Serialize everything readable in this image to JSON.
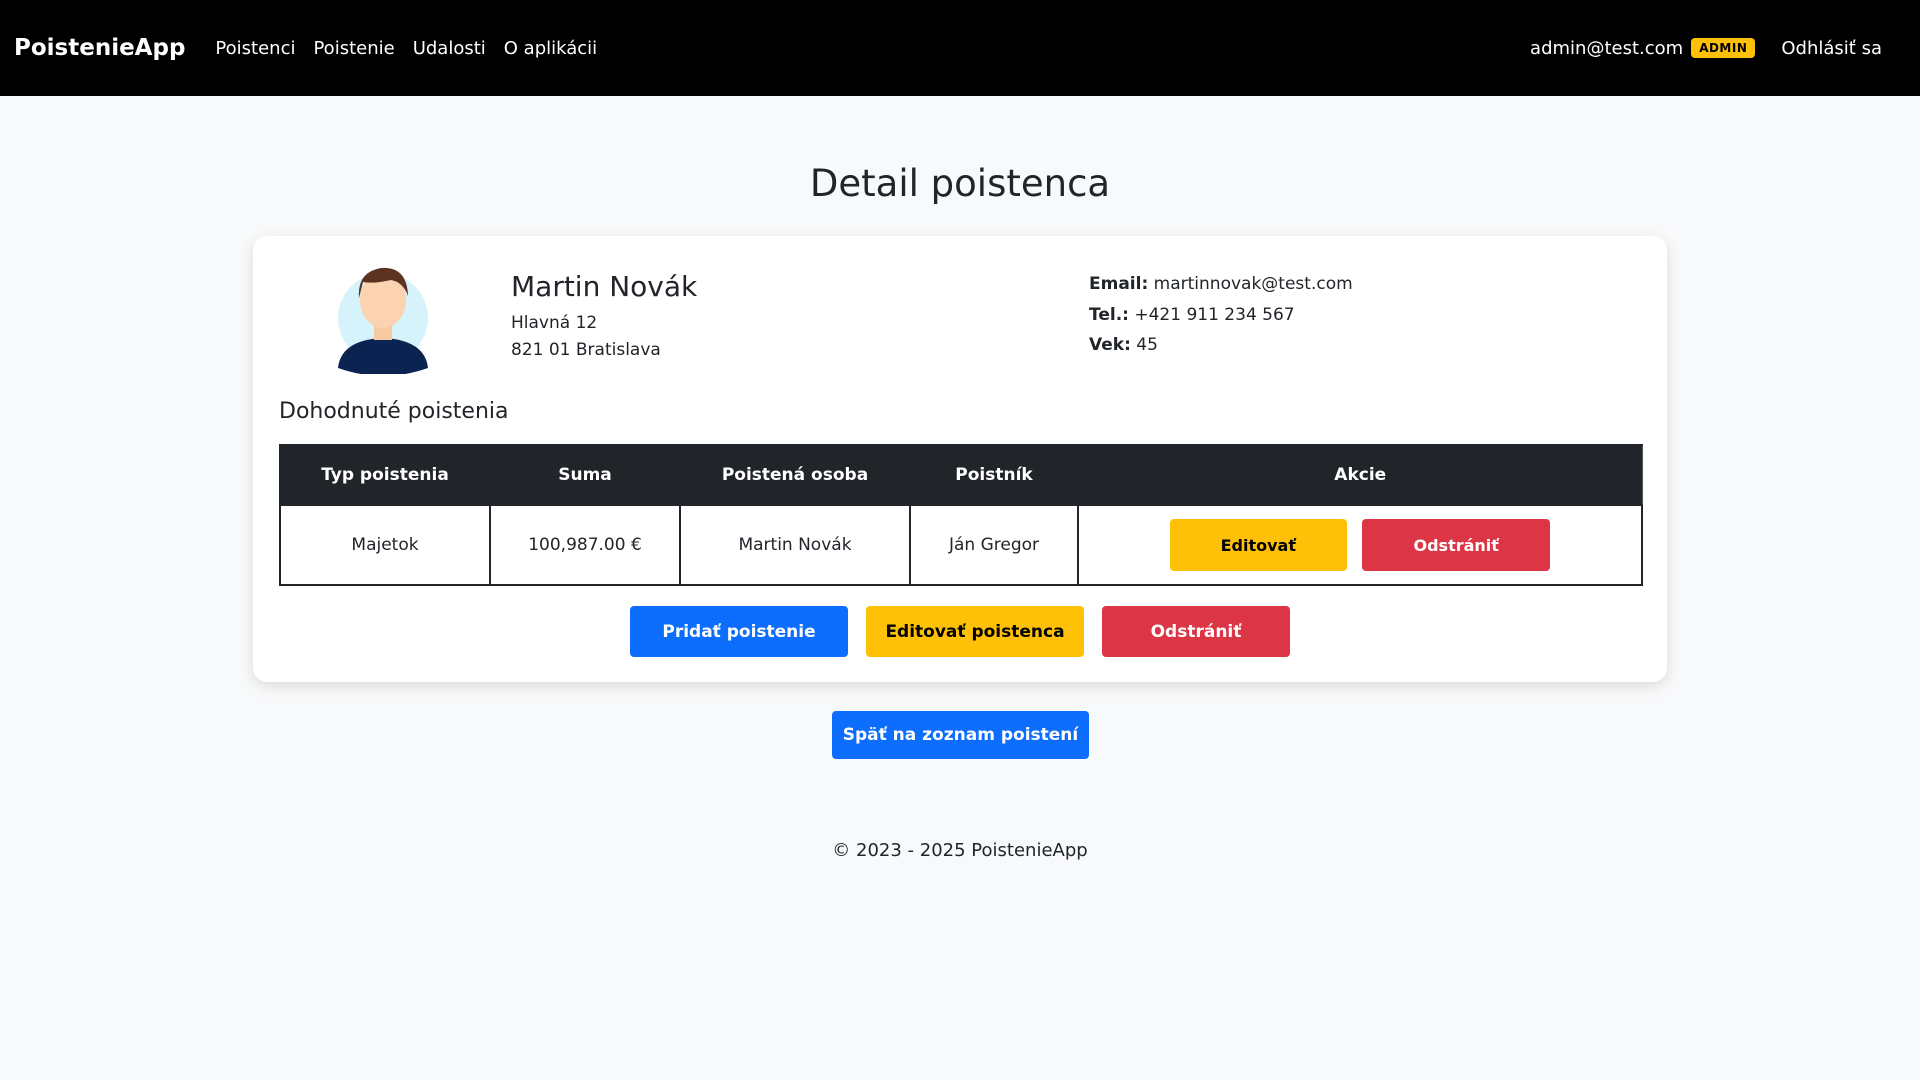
{
  "navbar": {
    "brand": "PoistenieApp",
    "links": [
      "Poistenci",
      "Poistenie",
      "Udalosti",
      "O aplikácii"
    ],
    "user_email": "admin@test.com",
    "role_badge": "ADMIN",
    "logout": "Odhlásiť sa"
  },
  "page": {
    "title": "Detail poistenca"
  },
  "insured": {
    "name": "Martin Novák",
    "street": "Hlavná 12",
    "city": "821 01 Bratislava",
    "email_label": "Email:",
    "email": "martinnovak@test.com",
    "phone_label": "Tel.:",
    "phone": "+421 911 234 567",
    "age_label": "Vek:",
    "age": "45"
  },
  "policies": {
    "section_title": "Dohodnuté poistenia",
    "headers": [
      "Typ poistenia",
      "Suma",
      "Poistená osoba",
      "Poistník",
      "Akcie"
    ],
    "rows": [
      {
        "type": "Majetok",
        "amount": "100,987.00 €",
        "insured_person": "Martin Novák",
        "policyholder": "Ján Gregor",
        "edit_label": "Editovať",
        "delete_label": "Odstrániť"
      }
    ]
  },
  "actions": {
    "add_policy": "Pridať poistenie",
    "edit_insured": "Editovať poistenca",
    "delete": "Odstrániť",
    "back": "Späť na zoznam poistení"
  },
  "footer": {
    "text": "© 2023 - 2025 PoistenieApp"
  },
  "colors": {
    "navbar": "#000000",
    "primary": "#0d6efd",
    "warning": "#ffc107",
    "danger": "#dc3545",
    "table_header": "#212529"
  }
}
